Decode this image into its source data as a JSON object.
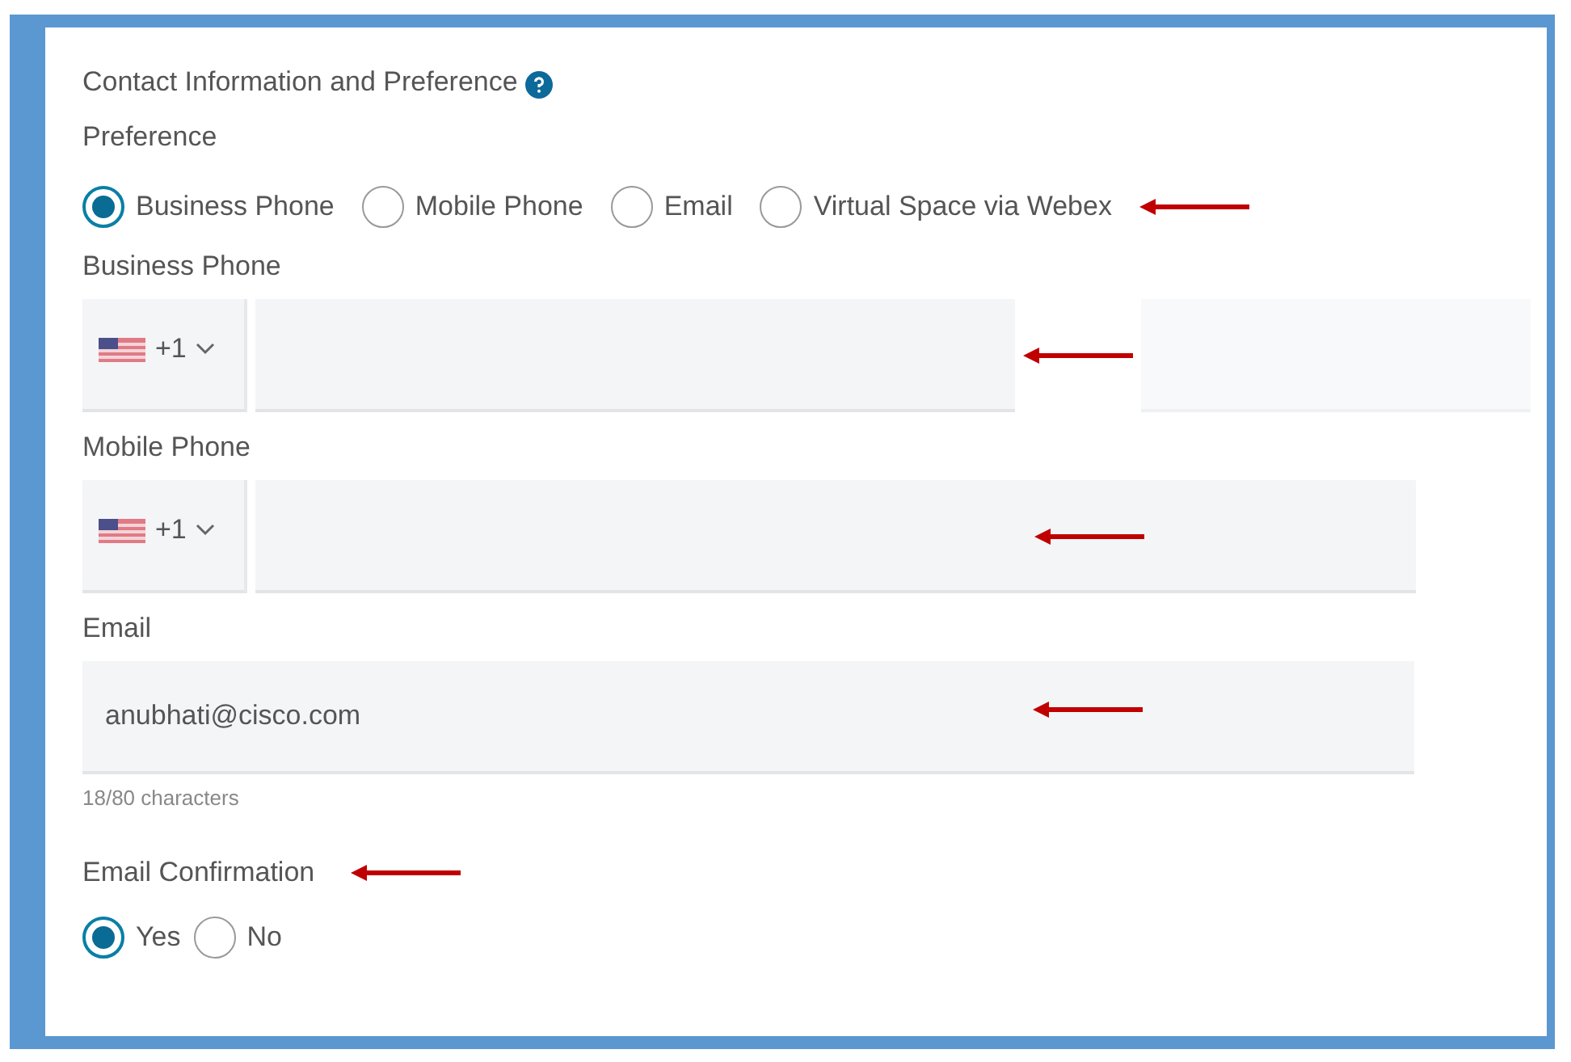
{
  "section": {
    "title": "Contact Information and Preference"
  },
  "preference": {
    "label": "Preference",
    "options": [
      {
        "label": "Business Phone",
        "selected": true
      },
      {
        "label": "Mobile Phone",
        "selected": false
      },
      {
        "label": "Email",
        "selected": false
      },
      {
        "label": "Virtual Space via Webex",
        "selected": false
      }
    ]
  },
  "phones": [
    {
      "label": "Business Phone",
      "country_code": "+1",
      "kind": "with-extension"
    },
    {
      "label": "Mobile Phone",
      "country_code": "+1",
      "kind": "plain"
    }
  ],
  "email": {
    "label": "Email",
    "value": "anubhati@cisco.com",
    "counter": "18/80 characters"
  },
  "email_confirmation": {
    "label": "Email Confirmation",
    "options": [
      {
        "label": "Yes",
        "selected": true
      },
      {
        "label": "No",
        "selected": false
      }
    ]
  }
}
